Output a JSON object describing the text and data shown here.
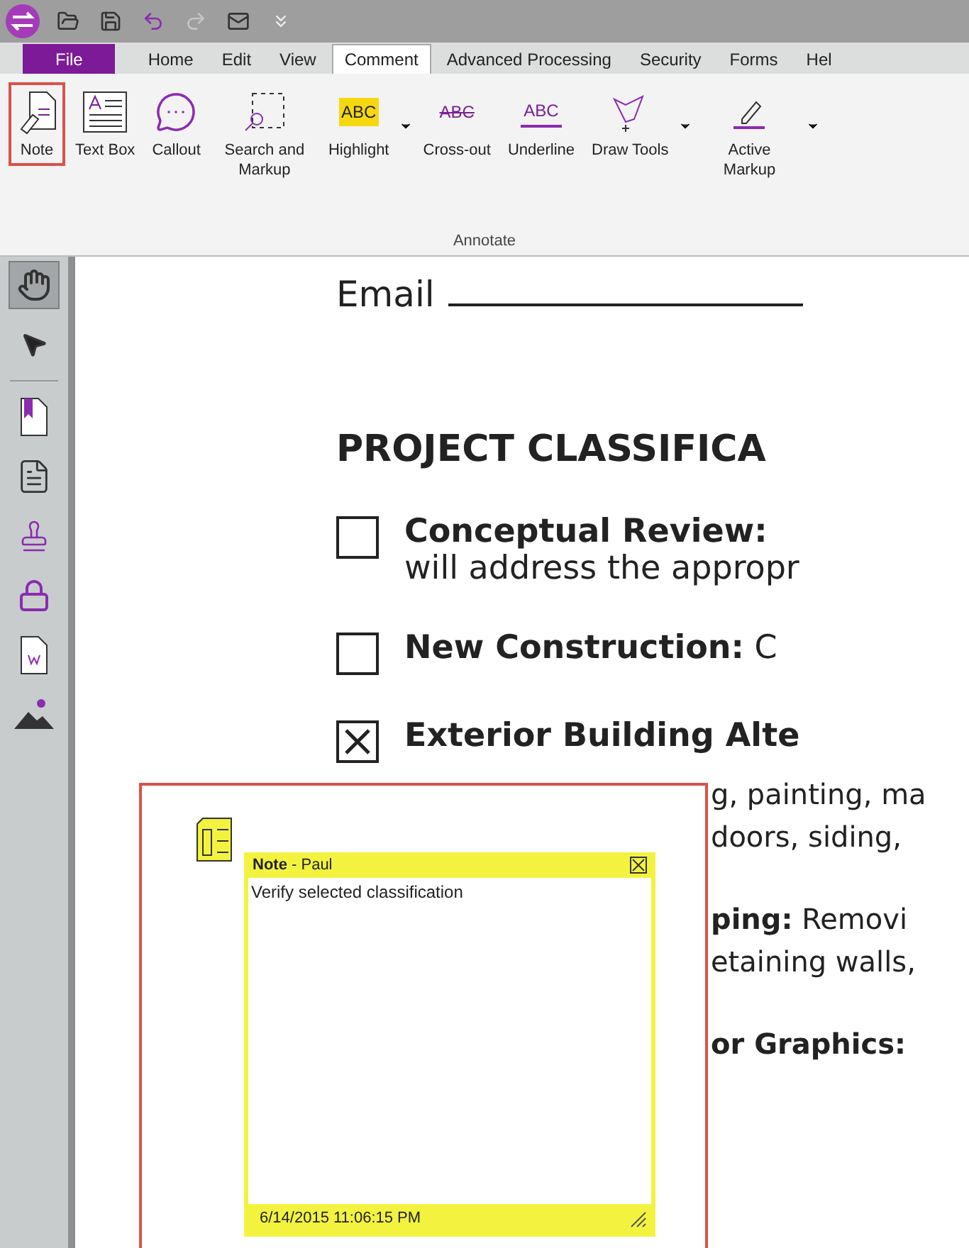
{
  "quick_access": [
    {
      "kind": "open",
      "disabled": false
    },
    {
      "kind": "save",
      "disabled": false
    },
    {
      "kind": "undo",
      "disabled": false
    },
    {
      "kind": "redo",
      "disabled": true
    },
    {
      "kind": "mail",
      "disabled": false
    },
    {
      "kind": "customize",
      "disabled": false
    }
  ],
  "tabs": [
    {
      "label": "File",
      "kind": "file",
      "selected": false
    },
    {
      "label": "Home",
      "kind": "tab",
      "selected": false
    },
    {
      "label": "Edit",
      "kind": "tab",
      "selected": false
    },
    {
      "label": "View",
      "kind": "tab",
      "selected": false
    },
    {
      "label": "Comment",
      "kind": "tab",
      "selected": true
    },
    {
      "label": "Advanced Processing",
      "kind": "tab",
      "selected": false
    },
    {
      "label": "Security",
      "kind": "tab",
      "selected": false
    },
    {
      "label": "Forms",
      "kind": "tab",
      "selected": false
    },
    {
      "label": "Hel",
      "kind": "tab",
      "selected": false
    }
  ],
  "ribbon": {
    "group": "Annotate",
    "items": [
      {
        "kind": "note",
        "label": "Note",
        "selected": true,
        "dropdown": false
      },
      {
        "kind": "textbox",
        "label": "Text Box",
        "selected": false,
        "dropdown": false
      },
      {
        "kind": "callout",
        "label": "Callout",
        "selected": false,
        "dropdown": false
      },
      {
        "kind": "search",
        "label": "Search and Markup",
        "selected": false,
        "dropdown": false
      },
      {
        "kind": "highlight",
        "label": "Highlight",
        "glyph": "ABC",
        "selected": false,
        "dropdown": true
      },
      {
        "kind": "crossout",
        "label": "Cross-out",
        "glyph": "ABC",
        "selected": false,
        "dropdown": false
      },
      {
        "kind": "underline",
        "label": "Underline",
        "glyph": "ABC",
        "selected": false,
        "dropdown": false
      },
      {
        "kind": "draw",
        "label": "Draw Tools",
        "selected": false,
        "dropdown": true
      },
      {
        "kind": "markup",
        "label": "Active Markup",
        "selected": false,
        "dropdown": true
      }
    ]
  },
  "sidebar": [
    {
      "kind": "hand",
      "selected": true
    },
    {
      "kind": "pointer",
      "selected": false
    },
    {
      "kind": "divider"
    },
    {
      "kind": "bookmark",
      "selected": false
    },
    {
      "kind": "page",
      "selected": false
    },
    {
      "kind": "stamp",
      "selected": false
    },
    {
      "kind": "lock",
      "selected": false
    },
    {
      "kind": "word",
      "selected": false
    },
    {
      "kind": "image",
      "selected": false
    }
  ],
  "document": {
    "email_label": "Email",
    "heading": "PROJECT CLASSIFICA",
    "options": [
      {
        "title": "Conceptual Review:",
        "line2": "will address the appropr",
        "checked": false
      },
      {
        "title": "New Construction:",
        "text": "C",
        "checked": false
      },
      {
        "title": "Exterior Building Alte",
        "checked": true
      }
    ],
    "fragments": [
      "g, painting, ma",
      "doors, siding,",
      "**ping:** Removi",
      "etaining walls,",
      "**or Graphics:**"
    ]
  },
  "note": {
    "title": "Note",
    "author": "- Paul",
    "text": "Verify selected classification",
    "date": "6/14/2015 11:06:15 PM"
  }
}
